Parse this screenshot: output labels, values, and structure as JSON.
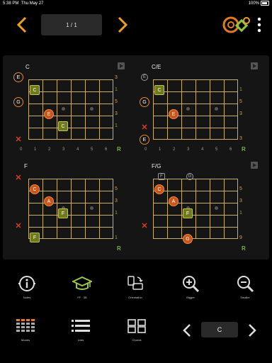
{
  "status": {
    "time": "5:38 PM",
    "date": "Thu May 27",
    "battery": "100%"
  },
  "pager": {
    "label": "1 / 1"
  },
  "charts": [
    {
      "name": "C",
      "left_marks": [
        "E",
        "",
        "G",
        "",
        "",
        "✕"
      ],
      "intervals": [
        "3",
        "1",
        "5",
        "3",
        "1",
        ""
      ],
      "notes": [
        "C",
        "E",
        "C"
      ]
    },
    {
      "name": "C/E",
      "left_marks": [
        "E",
        "",
        "G",
        "",
        "✕",
        "E"
      ],
      "intervals": [
        "",
        "1",
        "5",
        "3",
        "",
        "3"
      ],
      "notes": [
        "C",
        "E"
      ]
    },
    {
      "name": "F",
      "left_marks": [
        "✕",
        "",
        "",
        "",
        "✕",
        ""
      ],
      "intervals": [
        "5",
        "3",
        "1",
        "",
        "",
        "1"
      ],
      "notes": [
        "C",
        "A",
        "F",
        "F"
      ]
    },
    {
      "name": "F/G",
      "left_marks": [
        "",
        "",
        "",
        "",
        "✕",
        ""
      ],
      "top_marks": [
        "F",
        "G"
      ],
      "intervals": [
        "5",
        "3",
        "1",
        "",
        "",
        "9"
      ],
      "notes": [
        "C",
        "A",
        "F",
        "G"
      ]
    }
  ],
  "fret_numbers": [
    "0",
    "1",
    "2",
    "3",
    "4",
    "5",
    "6"
  ],
  "root_mark": "R",
  "toolbar": [
    {
      "label": "Notes",
      "icon": "info-icon"
    },
    {
      "label": "FF · 3B",
      "icon": "graduation-cap-icon"
    },
    {
      "label": "Orientation",
      "icon": "rotate-icon"
    },
    {
      "label": "Bigger",
      "icon": "zoom-in-icon"
    },
    {
      "label": "Smaller",
      "icon": "zoom-out-icon"
    }
  ],
  "bottom": [
    {
      "label": "Modes",
      "icon": "grid-dots-icon"
    },
    {
      "label": "Lists",
      "icon": "list-icon"
    },
    {
      "label": "Chords",
      "icon": "chords-grid-icon"
    }
  ],
  "current_chord": "C",
  "colors": {
    "accent": "#f0a020",
    "root_green": "#7bb135",
    "note_orange": "#c8541e",
    "mute_red": "#d93b2b"
  }
}
